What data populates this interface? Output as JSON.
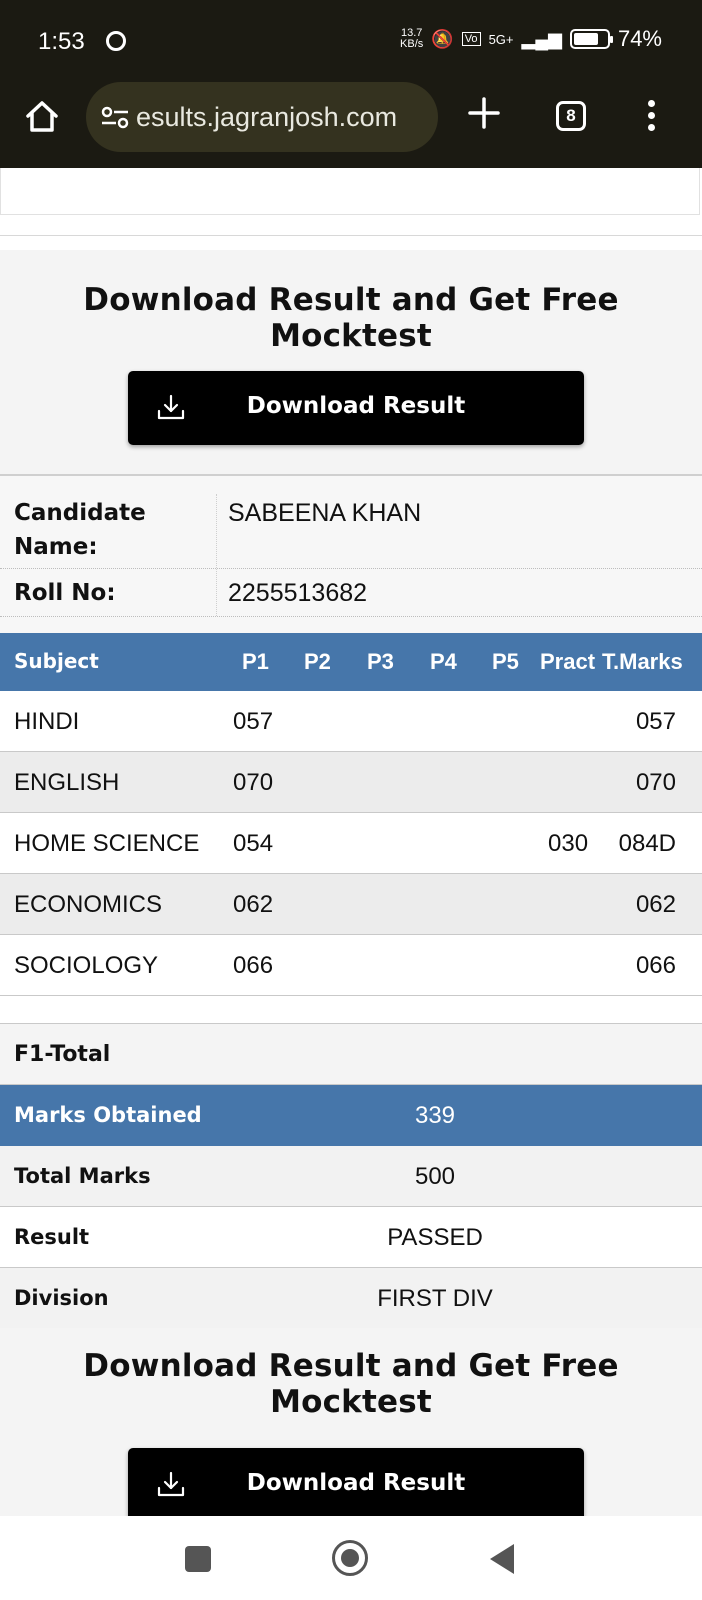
{
  "status_bar": {
    "time": "1:53",
    "net_speed_value": "13.7",
    "net_speed_unit": "KB/s",
    "network": "5G+",
    "battery_percent": "74%",
    "battery_level": 0.74
  },
  "browser": {
    "url": "esults.jagranjosh.com",
    "tab_count": "8"
  },
  "promo": {
    "title": "Download Result and Get Free Mocktest",
    "button_label": "Download Result"
  },
  "candidate": {
    "name_label": "Candidate Name:",
    "name_value": "SABEENA KHAN",
    "roll_label": "Roll No:",
    "roll_value": "2255513682"
  },
  "marks_table": {
    "headers": [
      "Subject",
      "P1",
      "P2",
      "P3",
      "P4",
      "P5",
      "Pract",
      "T.Marks"
    ],
    "rows": [
      {
        "subject": "HINDI",
        "p1": "057",
        "pract": "",
        "total": "057"
      },
      {
        "subject": "ENGLISH",
        "p1": "070",
        "pract": "",
        "total": "070"
      },
      {
        "subject": "HOME SCIENCE",
        "p1": "054",
        "pract": "030",
        "total": "084D"
      },
      {
        "subject": "ECONOMICS",
        "p1": "062",
        "pract": "",
        "total": "062"
      },
      {
        "subject": "SOCIOLOGY",
        "p1": "066",
        "pract": "",
        "total": "066"
      }
    ]
  },
  "summary": {
    "f1_label": "F1-Total",
    "marks_obtained_label": "Marks Obtained",
    "marks_obtained_value": "339",
    "total_marks_label": "Total Marks",
    "total_marks_value": "500",
    "result_label": "Result",
    "result_value": "PASSED",
    "division_label": "Division",
    "division_value": "FIRST DIV"
  },
  "icons": {
    "home": "home-icon",
    "site_settings": "tune-icon",
    "new_tab": "plus-icon",
    "tabs": "tab-switcher-icon",
    "menu": "kebab-menu-icon",
    "download": "download-icon"
  }
}
